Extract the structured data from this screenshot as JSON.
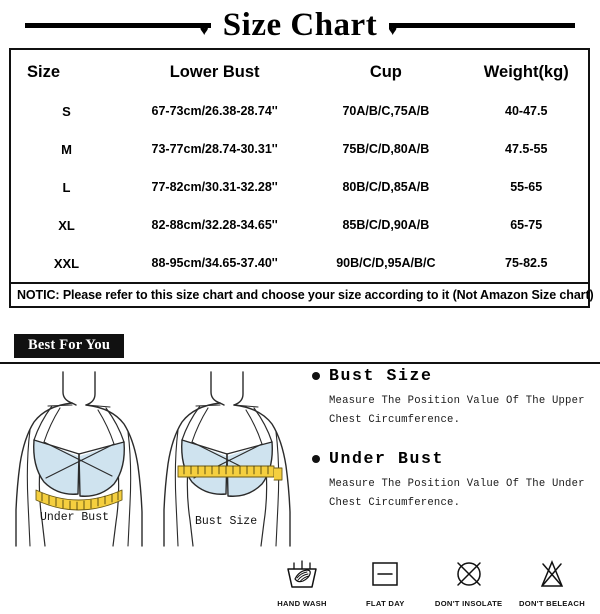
{
  "header": {
    "title": "Size Chart",
    "heart_icon": "heart"
  },
  "table": {
    "columns": [
      "Size",
      "Lower Bust",
      "Cup",
      "Weight(kg)"
    ],
    "rows": [
      {
        "size": "S",
        "lower_bust": "67-73cm/26.38-28.74''",
        "cup": "70A/B/C,75A/B",
        "weight": "40-47.5"
      },
      {
        "size": "M",
        "lower_bust": "73-77cm/28.74-30.31''",
        "cup": "75B/C/D,80A/B",
        "weight": "47.5-55"
      },
      {
        "size": "L",
        "lower_bust": "77-82cm/30.31-32.28''",
        "cup": "80B/C/D,85A/B",
        "weight": "55-65"
      },
      {
        "size": "XL",
        "lower_bust": "82-88cm/32.28-34.65''",
        "cup": "85B/C/D,90A/B",
        "weight": "65-75"
      },
      {
        "size": "XXL",
        "lower_bust": "88-95cm/34.65-37.40''",
        "cup": "90B/C/D,95A/B/C",
        "weight": "75-82.5"
      }
    ],
    "notice": "NOTIC: Please refer to this size chart and choose your size according to it (Not Amazon Size chart)"
  },
  "banner": {
    "label": "Best For You"
  },
  "figures": {
    "left_label": "Under Bust",
    "right_label": "Bust Size"
  },
  "measure": [
    {
      "heading": "Bust Size",
      "line1": "Measure The Position Value Of The Upper",
      "line2": "Chest Circumference."
    },
    {
      "heading": "Under Bust",
      "line1": "Measure The Position Value Of The Under",
      "line2": "Chest Circumference."
    }
  ],
  "care": [
    {
      "label": "HAND WASH",
      "icon": "hand-wash-icon"
    },
    {
      "label": "FLAT DAY",
      "icon": "dry-flat-icon"
    },
    {
      "label": "DON'T INSOLATE",
      "icon": "no-tumble-dry-icon"
    },
    {
      "label": "DON'T BELEACH",
      "icon": "no-bleach-icon"
    }
  ],
  "colors": {
    "ink": "#111111",
    "bra_fill": "#cfe3ef",
    "tape": "#f5cf3f",
    "skin_line": "#2b2b2b"
  }
}
